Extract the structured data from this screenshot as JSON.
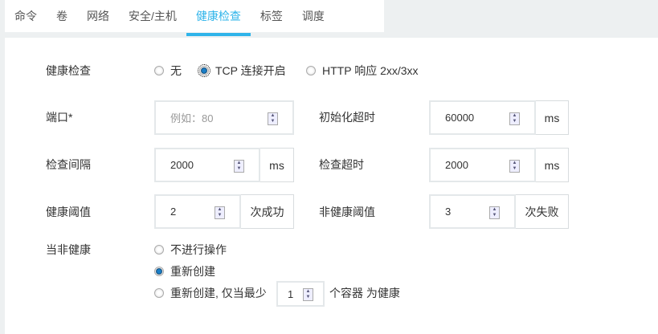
{
  "tabs": [
    "命令",
    "卷",
    "网络",
    "安全/主机",
    "健康检查",
    "标签",
    "调度"
  ],
  "active_tab": "健康检查",
  "health_check": {
    "label": "健康检查",
    "options": [
      "无",
      "TCP 连接开启",
      "HTTP 响应 2xx/3xx"
    ],
    "selected": "TCP 连接开启"
  },
  "port": {
    "label": "端口*",
    "placeholder": "例如：80"
  },
  "init_timeout": {
    "label": "初始化超时",
    "value": "60000",
    "unit": "ms"
  },
  "interval": {
    "label": "检查间隔",
    "value": "2000",
    "unit": "ms"
  },
  "check_timeout": {
    "label": "检查超时",
    "value": "2000",
    "unit": "ms"
  },
  "healthy_threshold": {
    "label": "健康阈值",
    "value": "2",
    "unit": "次成功"
  },
  "unhealthy_threshold": {
    "label": "非健康阈值",
    "value": "3",
    "unit": "次失败"
  },
  "when_unhealthy": {
    "label": "当非健康",
    "options": [
      "不进行操作",
      "重新创建",
      "重新创建, 仅当最少"
    ],
    "selected": "重新创建",
    "min_value": "1",
    "suffix": "个容器 为健康"
  }
}
